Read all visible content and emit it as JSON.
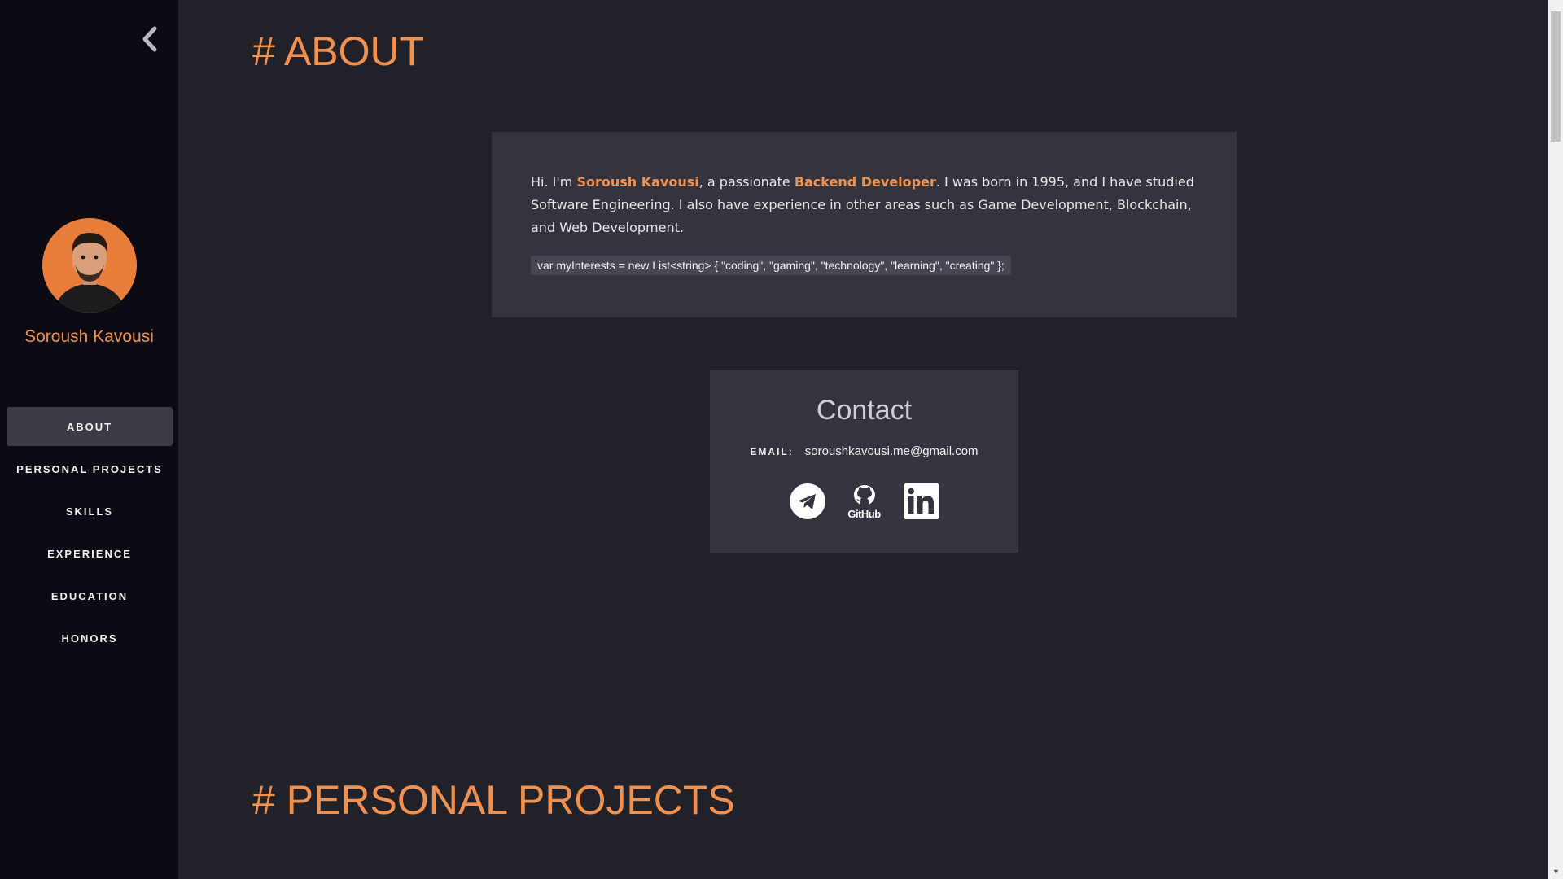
{
  "sidebar": {
    "profile_name": "Soroush Kavousi",
    "nav": [
      {
        "label": "ABOUT",
        "active": true
      },
      {
        "label": "PERSONAL PROJECTS",
        "active": false
      },
      {
        "label": "SKILLS",
        "active": false
      },
      {
        "label": "EXPERIENCE",
        "active": false
      },
      {
        "label": "EDUCATION",
        "active": false
      },
      {
        "label": "HONORS",
        "active": false
      }
    ]
  },
  "about": {
    "heading": "# ABOUT",
    "intro_1": "Hi. I'm ",
    "name_highlight": "Soroush Kavousi",
    "intro_2": ", a passionate ",
    "role_highlight": "Backend Developer",
    "intro_3": ". I was born in 1995, and I have studied Software Engineering. I also have experience in other areas such as Game Development, Blockchain, and Web Development.",
    "code": "var myInterests = new List<string> { \"coding\", \"gaming\", \"technology\", \"learning\", \"creating\" };"
  },
  "contact": {
    "title": "Contact",
    "email_label": "EMAIL:",
    "email_value": "soroushkavousi.me@gmail.com",
    "github_label": "GitHub",
    "socials": [
      "telegram-icon",
      "github-icon",
      "linkedin-icon"
    ]
  },
  "projects": {
    "heading": "# PERSONAL PROJECTS"
  },
  "colors": {
    "accent": "#f0914f",
    "background": "#21212a",
    "sidebar": "#0c0b14",
    "card": "#34343e"
  }
}
